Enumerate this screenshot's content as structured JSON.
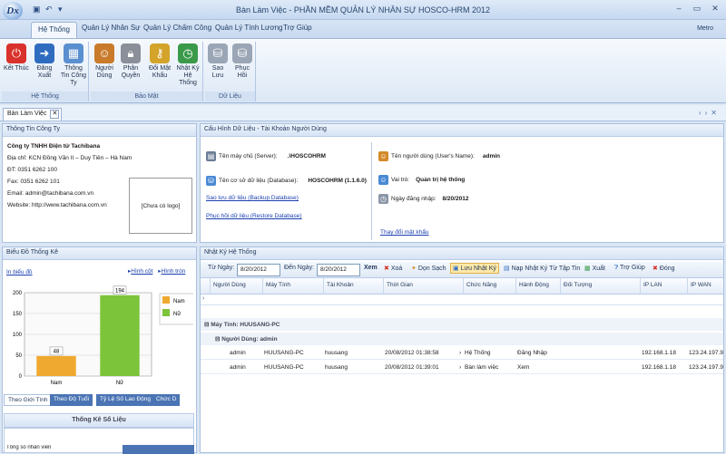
{
  "window": {
    "title": "Bàn Làm Việc - PHẦN MỀM QUẢN LÝ NHÂN SỰ HOSCO-HRM 2012",
    "logo_text": "Dx",
    "qat_icons": [
      "save-icon",
      "undo-icon",
      "dropdown-icon"
    ]
  },
  "ribbon_tabs": [
    "Hệ Thống",
    "Quản Lý Nhân Sự",
    "Quản Lý Chấm Công",
    "Quản Lý Tính Lương",
    "Trợ Giúp"
  ],
  "ribbon_right": "Metro",
  "ribbon_groups": [
    {
      "label": "Hệ Thống",
      "buttons": [
        {
          "label": "Kết Thúc",
          "icon": "power-icon"
        },
        {
          "label": "Đăng Xuất",
          "icon": "logout-icon"
        },
        {
          "label": "Thông Tin Công Ty",
          "icon": "building-icon"
        }
      ]
    },
    {
      "label": "Bảo Mật",
      "buttons": [
        {
          "label": "Người Dùng",
          "icon": "users-icon"
        },
        {
          "label": "Phân Quyền",
          "icon": "lock-icon"
        },
        {
          "label": "Đổi Mật Khẩu",
          "icon": "key-icon"
        },
        {
          "label": "Nhật Ký Hệ Thống",
          "icon": "clock-icon"
        }
      ]
    },
    {
      "label": "Dữ Liệu",
      "buttons": [
        {
          "label": "Sao Lưu",
          "icon": "database-icon"
        },
        {
          "label": "Phục Hồi",
          "icon": "restore-icon"
        }
      ]
    }
  ],
  "doc_tab": "Bàn Làm Việc",
  "company_panel": {
    "title": "Thông Tin Công Ty",
    "name": "Công ty TNHH Điện tử Tachibana",
    "address": "Địa chỉ: KCN Đồng Văn II – Duy Tiên – Hà Nam",
    "phone": "ĐT: 0351 6262 100",
    "fax": "Fax: 0351 6262 101",
    "email": "Email: admin@tachibana.com.vn",
    "website": "Website: http://www.tachibana.com.vn",
    "logo_placeholder": "[Chưa có logo]"
  },
  "db_panel": {
    "title": "Cấu Hình Dữ Liệu - Tài Khoản Người Dùng",
    "server_label": "Tên máy chủ (Server):",
    "server_value": ".\\HOSCOHRM",
    "db_label": "Tên cơ sở dữ liệu (Database):",
    "db_value": "HOSCOHRM (1.1.6.0)",
    "backup_link": "Sao lưu dữ liệu (Backup Database)",
    "restore_link": "Phục hồi dữ liệu (Restore Database)",
    "user_label": "Tên người dùng (User's Name):",
    "user_value": "admin",
    "role_label": "Vai trò:",
    "role_value": "Quản trị hệ thống",
    "login_label": "Ngày đăng nhập:",
    "login_value": "8/20/2012",
    "change_pw_link": "Thay đổi mật khẩu"
  },
  "stats_panel": {
    "title": "Biểu Đồ Thống Kê",
    "in_link": "In biểu đồ",
    "col_link": "Hình cột",
    "pie_link": "Hình tròn",
    "tabs": [
      "Theo Giới Tính",
      "Theo Độ Tuổi",
      "Tỷ Lệ Số Lao Động",
      "Chức D"
    ],
    "footer_title": "Thống Kê Số Liệu",
    "footer_row": "Tổng số nhân viên"
  },
  "chart_data": {
    "type": "bar",
    "categories": [
      "Nam",
      "Nữ"
    ],
    "values": [
      48,
      194
    ],
    "ylim": [
      0,
      200
    ],
    "yticks": [
      "200",
      "150",
      "100",
      "50",
      "0"
    ],
    "legend": [
      "Nam",
      "Nữ"
    ],
    "colors": [
      "#f0a930",
      "#7cc43a"
    ],
    "grid": true,
    "legend_position": "right"
  },
  "log_panel": {
    "title": "Nhật Ký Hệ Thống",
    "from_label": "Từ Ngày:",
    "from_value": "8/20/2012",
    "to_label": "Đến Ngày:",
    "to_value": "8/20/2012",
    "actions": [
      "Xem",
      "Xoá",
      "Dọn Sạch",
      "Lưu Nhật Ký",
      "Nạp Nhật Ký Từ Tập Tin",
      "Xuất",
      "Trợ Giúp",
      "Đóng"
    ],
    "columns": [
      "Người Dùng",
      "Máy Tính",
      "Tài Khoản",
      "Thời Gian",
      "Chức Năng",
      "Hành Động",
      "Đối Tượng",
      "IP LAN",
      "IP WAN"
    ],
    "group1": "Máy Tính: HUUSANG-PC",
    "group2": "Người Dùng: admin",
    "rows": [
      [
        "admin",
        "HUUSANG-PC",
        "huusang",
        "20/08/2012 01:38:58",
        "Hệ Thống",
        "Đăng Nhập",
        "",
        "192.168.1.18",
        "123.24.197.9"
      ],
      [
        "admin",
        "HUUSANG-PC",
        "huusang",
        "20/08/2012 01:39:01",
        "Bàn làm việc",
        "Xem",
        "",
        "192.168.1.18",
        "123.24.197.9"
      ]
    ]
  }
}
